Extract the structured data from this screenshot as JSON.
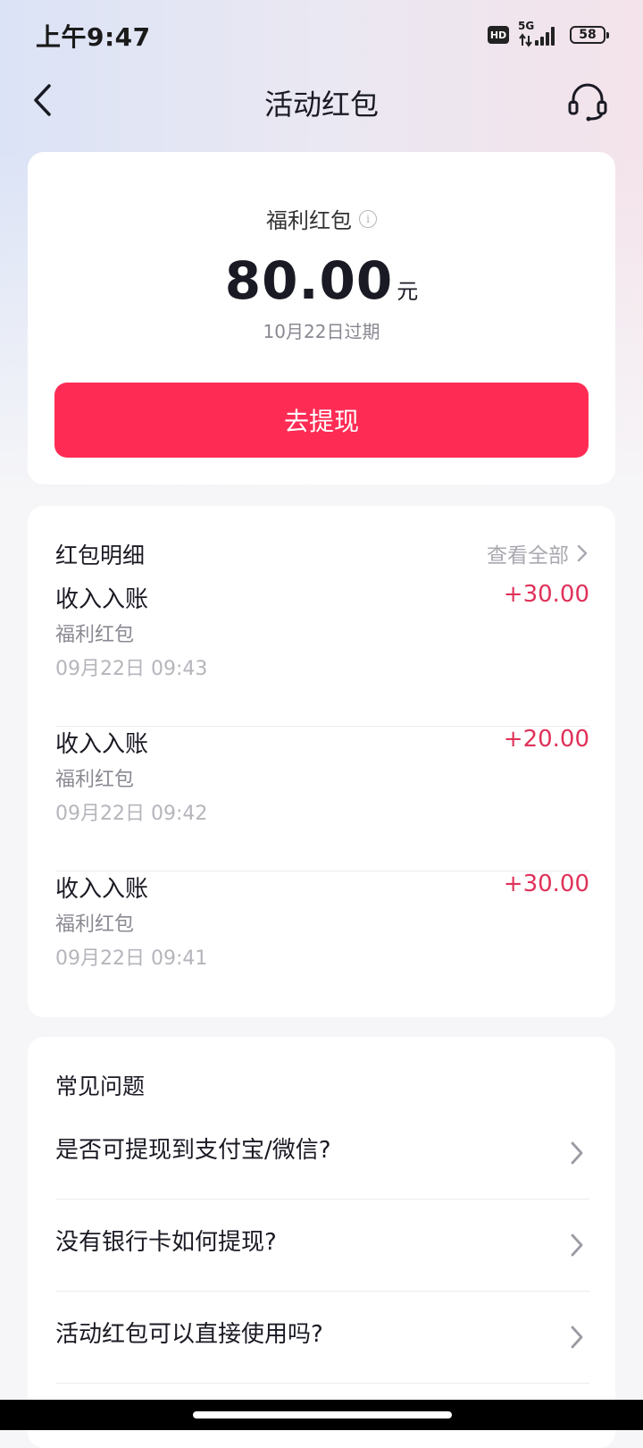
{
  "status_bar": {
    "time": "上午9:47",
    "hd_label": "HD",
    "network_label": "5G",
    "battery_level": "58"
  },
  "nav": {
    "title": "活动红包"
  },
  "balance": {
    "title": "福利红包",
    "amount": "80.00",
    "unit": "元",
    "expiry": "10月22日过期",
    "withdraw_label": "去提现"
  },
  "details": {
    "title": "红包明细",
    "view_all_label": "查看全部",
    "items": [
      {
        "type": "收入入账",
        "source": "福利红包",
        "time": "09月22日 09:43",
        "amount": "+30.00"
      },
      {
        "type": "收入入账",
        "source": "福利红包",
        "time": "09月22日 09:42",
        "amount": "+20.00"
      },
      {
        "type": "收入入账",
        "source": "福利红包",
        "time": "09月22日 09:41",
        "amount": "+30.00"
      }
    ]
  },
  "faq": {
    "title": "常见问题",
    "items": [
      {
        "question": "是否可提现到支付宝/微信?"
      },
      {
        "question": "没有银行卡如何提现?"
      },
      {
        "question": "活动红包可以直接使用吗?"
      }
    ]
  },
  "colors": {
    "accent": "#fe2c55",
    "income": "#e0325a"
  }
}
